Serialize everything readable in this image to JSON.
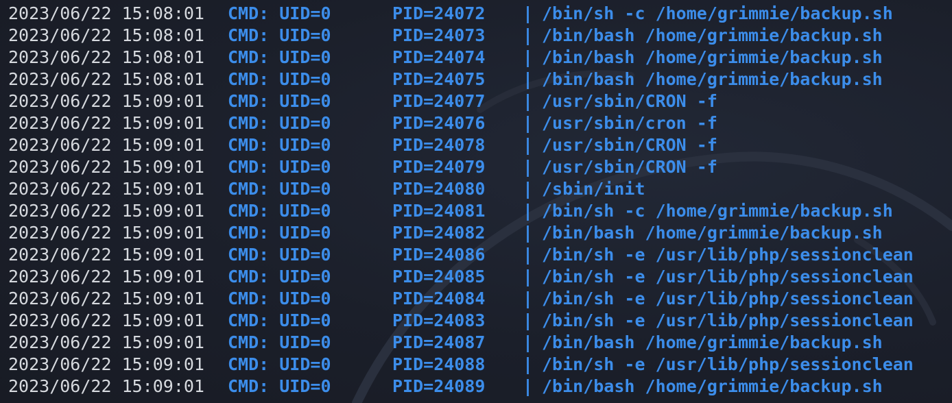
{
  "log_lines": [
    {
      "timestamp": "2023/06/22 15:08:01",
      "cmd": "CMD: UID=0",
      "pid": "PID=24072",
      "sep": "|",
      "command": "/bin/sh -c /home/grimmie/backup.sh"
    },
    {
      "timestamp": "2023/06/22 15:08:01",
      "cmd": "CMD: UID=0",
      "pid": "PID=24073",
      "sep": "|",
      "command": "/bin/bash /home/grimmie/backup.sh"
    },
    {
      "timestamp": "2023/06/22 15:08:01",
      "cmd": "CMD: UID=0",
      "pid": "PID=24074",
      "sep": "|",
      "command": "/bin/bash /home/grimmie/backup.sh"
    },
    {
      "timestamp": "2023/06/22 15:08:01",
      "cmd": "CMD: UID=0",
      "pid": "PID=24075",
      "sep": "|",
      "command": "/bin/bash /home/grimmie/backup.sh"
    },
    {
      "timestamp": "2023/06/22 15:09:01",
      "cmd": "CMD: UID=0",
      "pid": "PID=24077",
      "sep": "|",
      "command": "/usr/sbin/CRON -f"
    },
    {
      "timestamp": "2023/06/22 15:09:01",
      "cmd": "CMD: UID=0",
      "pid": "PID=24076",
      "sep": "|",
      "command": "/usr/sbin/cron -f"
    },
    {
      "timestamp": "2023/06/22 15:09:01",
      "cmd": "CMD: UID=0",
      "pid": "PID=24078",
      "sep": "|",
      "command": "/usr/sbin/CRON -f"
    },
    {
      "timestamp": "2023/06/22 15:09:01",
      "cmd": "CMD: UID=0",
      "pid": "PID=24079",
      "sep": "|",
      "command": "/usr/sbin/CRON -f"
    },
    {
      "timestamp": "2023/06/22 15:09:01",
      "cmd": "CMD: UID=0",
      "pid": "PID=24080",
      "sep": "|",
      "command": "/sbin/init"
    },
    {
      "timestamp": "2023/06/22 15:09:01",
      "cmd": "CMD: UID=0",
      "pid": "PID=24081",
      "sep": "|",
      "command": "/bin/sh -c /home/grimmie/backup.sh"
    },
    {
      "timestamp": "2023/06/22 15:09:01",
      "cmd": "CMD: UID=0",
      "pid": "PID=24082",
      "sep": "|",
      "command": "/bin/bash /home/grimmie/backup.sh"
    },
    {
      "timestamp": "2023/06/22 15:09:01",
      "cmd": "CMD: UID=0",
      "pid": "PID=24086",
      "sep": "|",
      "command": "/bin/sh -e /usr/lib/php/sessionclean"
    },
    {
      "timestamp": "2023/06/22 15:09:01",
      "cmd": "CMD: UID=0",
      "pid": "PID=24085",
      "sep": "|",
      "command": "/bin/sh -e /usr/lib/php/sessionclean"
    },
    {
      "timestamp": "2023/06/22 15:09:01",
      "cmd": "CMD: UID=0",
      "pid": "PID=24084",
      "sep": "|",
      "command": "/bin/sh -e /usr/lib/php/sessionclean"
    },
    {
      "timestamp": "2023/06/22 15:09:01",
      "cmd": "CMD: UID=0",
      "pid": "PID=24083",
      "sep": "|",
      "command": "/bin/sh -e /usr/lib/php/sessionclean"
    },
    {
      "timestamp": "2023/06/22 15:09:01",
      "cmd": "CMD: UID=0",
      "pid": "PID=24087",
      "sep": "|",
      "command": "/bin/bash /home/grimmie/backup.sh"
    },
    {
      "timestamp": "2023/06/22 15:09:01",
      "cmd": "CMD: UID=0",
      "pid": "PID=24088",
      "sep": "|",
      "command": "/bin/sh -e /usr/lib/php/sessionclean"
    },
    {
      "timestamp": "2023/06/22 15:09:01",
      "cmd": "CMD: UID=0",
      "pid": "PID=24089",
      "sep": "|",
      "command": "/bin/bash /home/grimmie/backup.sh"
    }
  ],
  "colors": {
    "background": "#1b1f2a",
    "timestamp": "#d6d9de",
    "accent": "#3c8dea"
  },
  "icons": {
    "watermark": "dragon-watermark-icon"
  }
}
